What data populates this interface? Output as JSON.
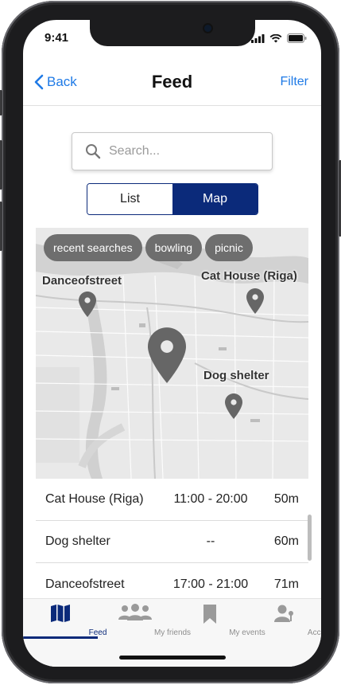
{
  "status": {
    "time": "9:41"
  },
  "nav": {
    "back_label": "Back",
    "title": "Feed",
    "filter_label": "Filter"
  },
  "search": {
    "placeholder": "Search..."
  },
  "view_toggle": {
    "list_label": "List",
    "map_label": "Map",
    "selected": "Map"
  },
  "map": {
    "chips": [
      "recent searches",
      "bowling",
      "picnic"
    ],
    "labels": {
      "danceofstreet": "Danceofstreet",
      "cat_house": "Cat House (Riga)",
      "dog_shelter": "Dog shelter"
    }
  },
  "list": [
    {
      "name": "Cat House (Riga)",
      "hours": "11:00 - 20:00",
      "distance": "50m"
    },
    {
      "name": "Dog shelter",
      "hours": "--",
      "distance": "60m"
    },
    {
      "name": "Danceofstreet",
      "hours": "17:00 - 21:00",
      "distance": "71m"
    }
  ],
  "tabs": [
    {
      "label": "Feed",
      "icon": "map-icon",
      "active": true
    },
    {
      "label": "My friends",
      "icon": "people-icon",
      "active": false
    },
    {
      "label": "My events",
      "icon": "bookmark-icon",
      "active": false
    },
    {
      "label": "Account",
      "icon": "account-icon",
      "active": false
    }
  ],
  "colors": {
    "accent": "#0b2a7a",
    "link": "#1f7ae6",
    "pin": "#666666"
  }
}
